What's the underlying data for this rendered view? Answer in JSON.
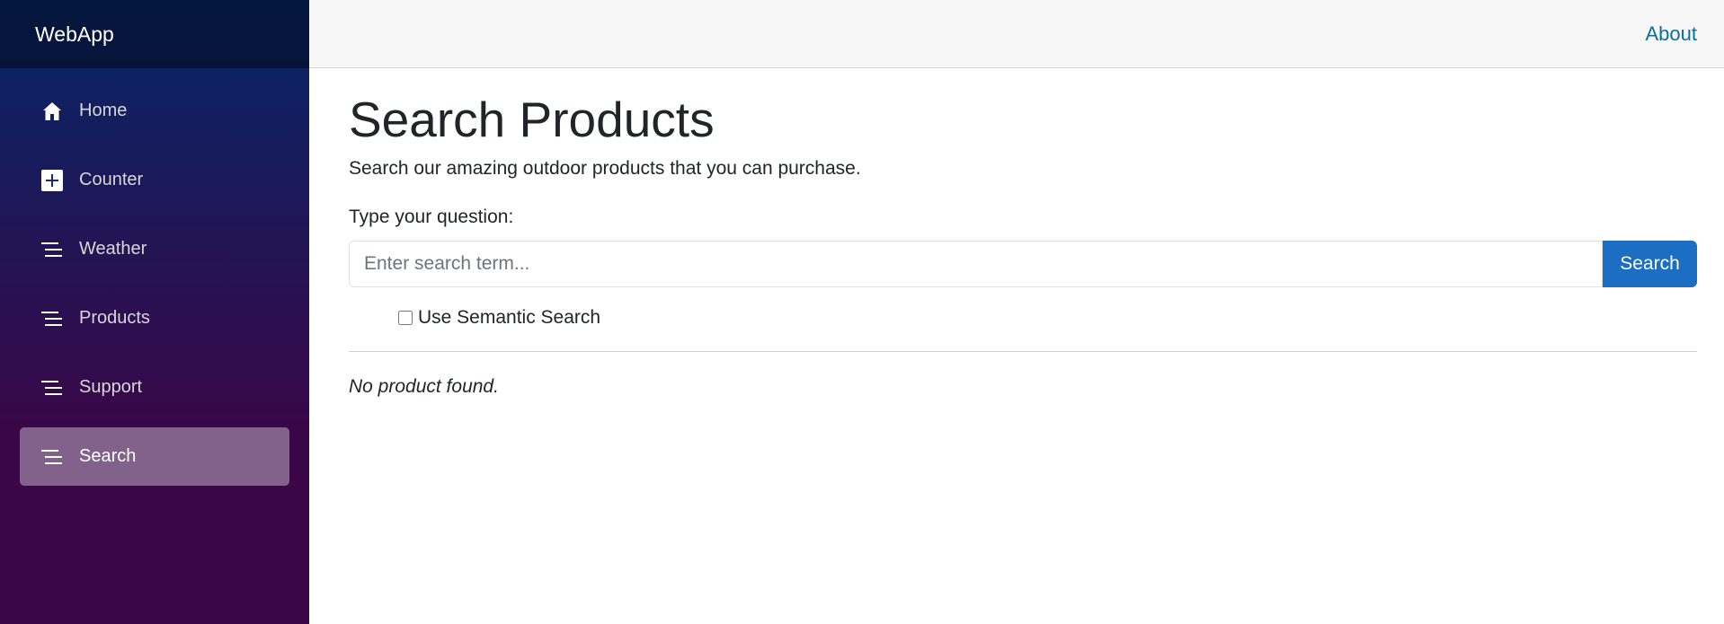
{
  "brand": "WebApp",
  "nav": {
    "items": [
      {
        "label": "Home",
        "icon": "home-icon"
      },
      {
        "label": "Counter",
        "icon": "plus-square-icon"
      },
      {
        "label": "Weather",
        "icon": "list-icon"
      },
      {
        "label": "Products",
        "icon": "list-icon"
      },
      {
        "label": "Support",
        "icon": "list-icon"
      },
      {
        "label": "Search",
        "icon": "list-icon",
        "active": true
      }
    ]
  },
  "top": {
    "about": "About"
  },
  "page": {
    "title": "Search Products",
    "intro": "Search our amazing outdoor products that you can purchase.",
    "question_label": "Type your question:",
    "search_value": "",
    "search_placeholder": "Enter search term...",
    "search_button": "Search",
    "semantic_label": "Use Semantic Search",
    "semantic_checked": false,
    "result_message": "No product found."
  },
  "colors": {
    "sidebar_top": "#052767",
    "sidebar_bottom": "#3a0647",
    "primary": "#1b6ec2",
    "link": "#0a6ea1"
  }
}
